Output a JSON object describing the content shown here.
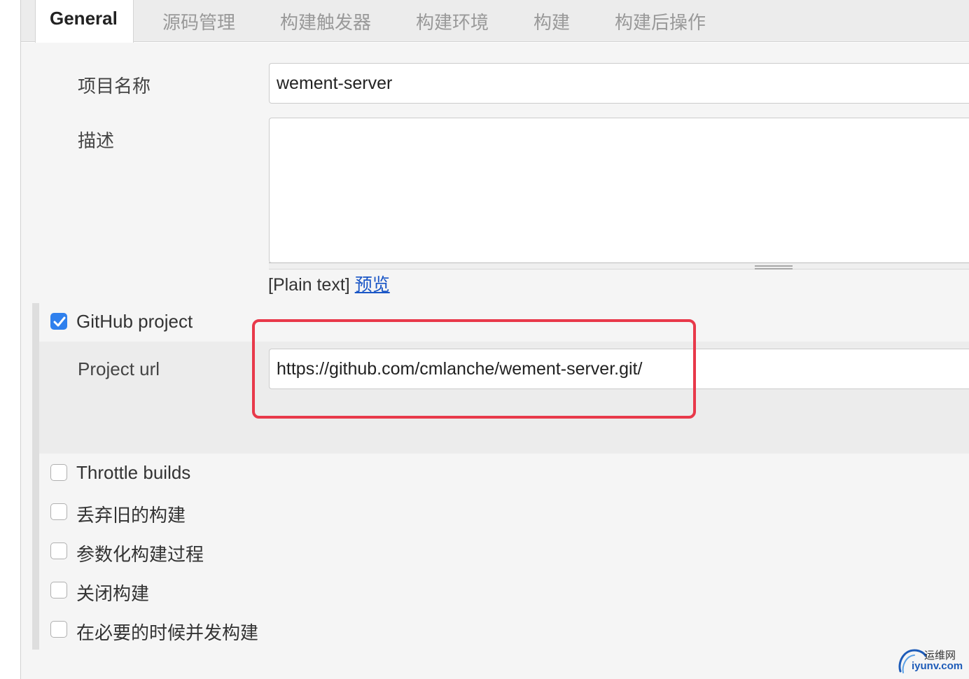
{
  "tabs": [
    {
      "label": "General",
      "active": true
    },
    {
      "label": "源码管理",
      "active": false
    },
    {
      "label": "构建触发器",
      "active": false
    },
    {
      "label": "构建环境",
      "active": false
    },
    {
      "label": "构建",
      "active": false
    },
    {
      "label": "构建后操作",
      "active": false
    }
  ],
  "form": {
    "project_name_label": "项目名称",
    "project_name_value": "wement-server",
    "description_label": "描述",
    "description_value": "",
    "plain_text_prefix": "[Plain text]",
    "preview_link": "预览"
  },
  "github_project": {
    "label": "GitHub project",
    "checked": true,
    "project_url_label": "Project url",
    "project_url_value": "https://github.com/cmlanche/wement-server.git/"
  },
  "options": [
    {
      "label": "Throttle builds",
      "checked": false
    },
    {
      "label": "丢弃旧的构建",
      "checked": false
    },
    {
      "label": "参数化构建过程",
      "checked": false
    },
    {
      "label": "关闭构建",
      "checked": false
    },
    {
      "label": "在必要的时候并发构建",
      "checked": false
    }
  ],
  "watermark": {
    "cn": "运维网",
    "en": "iyunv.com"
  },
  "colors": {
    "highlight": "#e8394a",
    "checkbox_checked": "#2f80ed",
    "link": "#1a56c6"
  }
}
